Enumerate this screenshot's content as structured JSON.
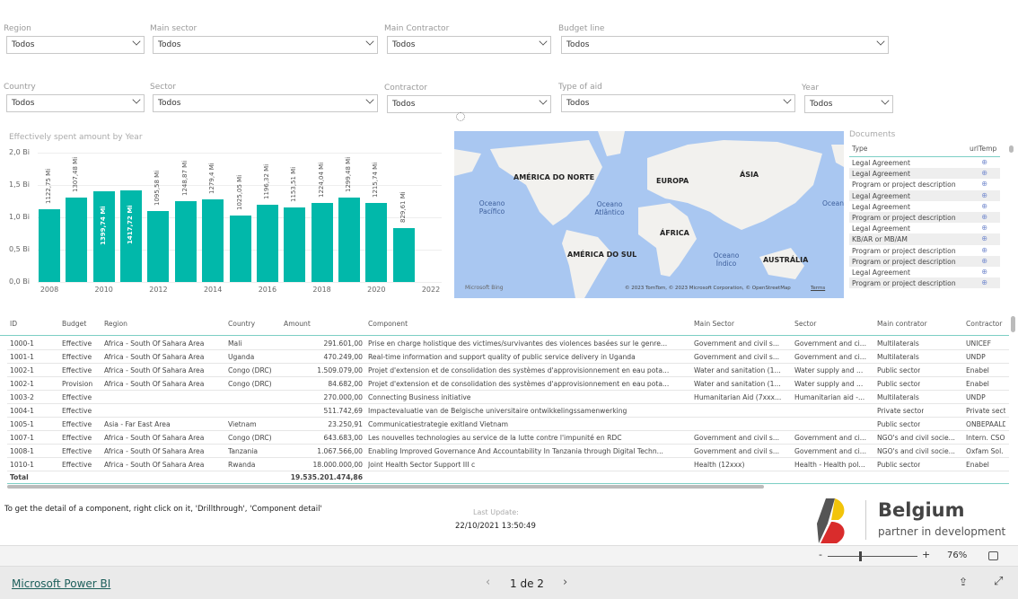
{
  "filters": [
    {
      "label": "Region",
      "value": "Todos"
    },
    {
      "label": "Main sector",
      "value": "Todos"
    },
    {
      "label": "Main Contractor",
      "value": "Todos"
    },
    {
      "label": "Budget line",
      "value": "Todos"
    },
    {
      "label": "Country",
      "value": "Todos"
    },
    {
      "label": "Sector",
      "value": "Todos"
    },
    {
      "label": "Contractor",
      "value": "Todos"
    },
    {
      "label": "Type of aid",
      "value": "Todos"
    },
    {
      "label": "Year",
      "value": "Todos"
    }
  ],
  "chart_data": {
    "type": "bar",
    "title": "Effectively spent amount by Year",
    "categories": [
      "2008",
      "2009",
      "2010",
      "2011",
      "2012",
      "2013",
      "2014",
      "2015",
      "2016",
      "2017",
      "2018",
      "2019",
      "2020",
      "2021"
    ],
    "values": [
      1122.75,
      1307.48,
      1399.74,
      1417.72,
      1095.58,
      1248.87,
      1279.4,
      1025.05,
      1196.32,
      1153.51,
      1224.04,
      1299.48,
      1215.74,
      829.61
    ],
    "data_labels": [
      "1122,75 Mi",
      "1307,48 Mi",
      "1399,74 Mi",
      "1417,72 Mi",
      "1095,58 Mi",
      "1248,87 Mi",
      "1279,4 Mi",
      "1025,05 Mi",
      "1196,32 Mi",
      "1153,51 Mi",
      "1224,04 Mi",
      "1299,48 Mi",
      "1215,74 Mi",
      "829,61 Mi"
    ],
    "yticks": [
      "0,0 Bi",
      "0,5 Bi",
      "1,0 Bi",
      "1,5 Bi",
      "2,0 Bi"
    ],
    "xticks": [
      "2008",
      "2010",
      "2012",
      "2014",
      "2016",
      "2018",
      "2020",
      "2022"
    ],
    "ylim": [
      0,
      2000
    ],
    "yunit": "Mi",
    "color": "#01B8AA",
    "grid": true
  },
  "map": {
    "labels": [
      "AMÉRICA DO NORTE",
      "EUROPA",
      "ÁSIA",
      "ÁFRICA",
      "AMÉRICA DO SUL",
      "AUSTRÁLIA"
    ],
    "oceans": [
      "Oceano Pacífico",
      "Oceano Atlântico",
      "Oceano Índico",
      "Ocean"
    ],
    "logo": "Microsoft Bing",
    "attribution": "© 2023 TomTom, © 2023 Microsoft Corporation, © OpenStreetMap",
    "terms": "Terms"
  },
  "documents": {
    "title": "Documents",
    "columns": [
      "Type",
      "urlTemp"
    ],
    "rows": [
      "Legal Agreement",
      "Legal Agreement",
      "Program or project description",
      "Legal Agreement",
      "Legal Agreement",
      "Program or project description",
      "Legal Agreement",
      "KB/AR or MB/AM",
      "Program or project description",
      "Program or project description",
      "Legal Agreement",
      "Program or project description"
    ]
  },
  "table": {
    "columns": [
      "ID",
      "Budget",
      "Region",
      "Country",
      "Amount",
      "Component",
      "Main Sector",
      "Sector",
      "Main contrator",
      "Contractor"
    ],
    "rows": [
      [
        "1000-1",
        "Effective",
        "Africa - South Of Sahara Area",
        "Mali",
        "291.601,00",
        "Prise en charge holistique des victimes/survivantes des violences basées sur le genre...",
        "Government and civil s...",
        "Government and ci...",
        "Multilaterals",
        "UNICEF"
      ],
      [
        "1001-1",
        "Effective",
        "Africa - South Of Sahara Area",
        "Uganda",
        "470.249,00",
        "Real-time information and support quality of public service delivery in Uganda",
        "Government and civil s...",
        "Government and ci...",
        "Multilaterals",
        "UNDP"
      ],
      [
        "1002-1",
        "Effective",
        "Africa - South Of Sahara Area",
        "Congo (DRC)",
        "1.509.079,00",
        "Projet d'extension et de consolidation des systèmes d'approvisionnement en eau pota...",
        "Water and sanitation (1...",
        "Water supply and ...",
        "Public sector",
        "Enabel"
      ],
      [
        "1002-1",
        "Provision",
        "Africa - South Of Sahara Area",
        "Congo (DRC)",
        "84.682,00",
        "Projet d'extension et de consolidation des systèmes d'approvisionnement en eau pota...",
        "Water and sanitation (1...",
        "Water supply and ...",
        "Public sector",
        "Enabel"
      ],
      [
        "1003-2",
        "Effective",
        "",
        "",
        "270.000,00",
        "Connecting Business initiative",
        "Humanitarian Aid (7xxx...",
        "Humanitarian aid -...",
        "Multilaterals",
        "UNDP"
      ],
      [
        "1004-1",
        "Effective",
        "",
        "",
        "511.742,69",
        "Impactevaluatie van de Belgische universitaire ontwikkelingssamenwerking",
        "",
        "",
        "Private sector",
        "Private sect"
      ],
      [
        "1005-1",
        "Effective",
        "Asia - Far East Area",
        "Vietnam",
        "23.250,91",
        "Communicatiestrategie exitland Vietnam",
        "",
        "",
        "Public sector",
        "ONBEPAALD"
      ],
      [
        "1007-1",
        "Effective",
        "Africa - South Of Sahara Area",
        "Congo (DRC)",
        "643.683,00",
        "Les nouvelles technologies au service de la lutte contre l'impunité en RDC",
        "Government and civil s...",
        "Government and ci...",
        "NGO's and civil socie...",
        "Intern. CSO"
      ],
      [
        "1008-1",
        "Effective",
        "Africa - South Of Sahara Area",
        "Tanzania",
        "1.067.566,00",
        "Enabling Improved Governance And Accountability In Tanzania through Digital Techn...",
        "Government and civil s...",
        "Government and ci...",
        "NGO's and civil socie...",
        "Oxfam Sol."
      ],
      [
        "1010-1",
        "Effective",
        "Africa - South Of Sahara Area",
        "Rwanda",
        "18.000.000,00",
        "Joint Health Sector Support III c",
        "Health (12xxx)",
        "Health - Health pol...",
        "Public sector",
        "Enabel"
      ]
    ],
    "total_label": "Total",
    "total_amount": "19.535.201.474,86"
  },
  "footer": {
    "hint": "To get the detail of a component, right click on it, 'Drillthrough', 'Component detail'",
    "last_update_label": "Last Update:",
    "last_update_value": "22/10/2021 13:50:49",
    "logo_title": "Belgium",
    "logo_subtitle": "partner in development"
  },
  "zoombar": {
    "minus": "-",
    "plus": "+",
    "zoom": "76%",
    "zoom_percent": 76
  },
  "bottombar": {
    "brand": "Microsoft Power BI",
    "page": "1 de 2"
  }
}
